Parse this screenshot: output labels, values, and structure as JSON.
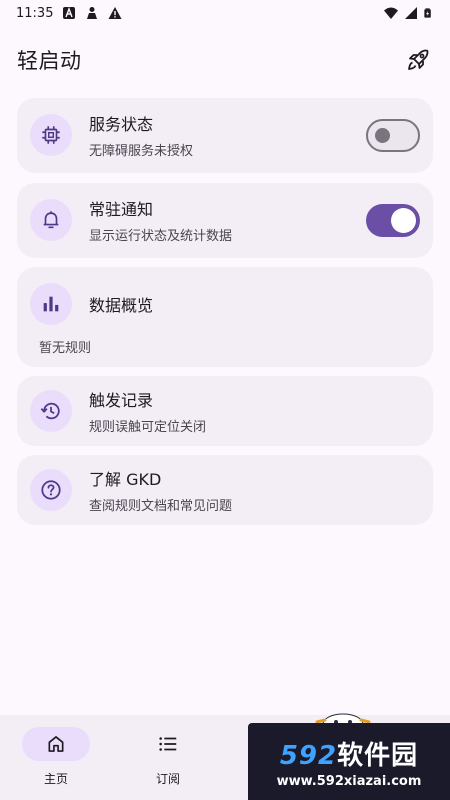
{
  "status_bar": {
    "time": "11:35",
    "icons": [
      "a-badge-icon",
      "person-icon",
      "warning-icon",
      "wifi-icon",
      "signal-icon",
      "battery-icon"
    ]
  },
  "header": {
    "title": "轻启动",
    "action_icon": "rocket-icon"
  },
  "cards": {
    "service": {
      "title": "服务状态",
      "subtitle": "无障碍服务未授权",
      "icon": "chip-icon",
      "switch_on": false
    },
    "notify": {
      "title": "常驻通知",
      "subtitle": "显示运行状态及统计数据",
      "icon": "bell-icon",
      "switch_on": true
    },
    "stats": {
      "title": "数据概览",
      "empty": "暂无规则",
      "icon": "bar-chart-icon"
    },
    "history": {
      "title": "触发记录",
      "subtitle": "规则误触可定位关闭",
      "icon": "history-icon"
    },
    "about": {
      "title": "了解 GKD",
      "subtitle": "查阅规则文档和常见问题",
      "icon": "help-icon"
    }
  },
  "bottom_nav": {
    "items": [
      {
        "label": "主页",
        "icon": "home-icon",
        "active": true
      },
      {
        "label": "订阅",
        "icon": "list-icon",
        "active": false
      }
    ]
  },
  "watermark": {
    "brand_number": "592",
    "brand_text": "软件园",
    "url": "www.592xiazai.com"
  },
  "colors": {
    "background": "#fdf7fe",
    "card": "#f3edf6",
    "icon_bg": "#e9ddfb",
    "accent": "#6b4fa6",
    "icon_fg": "#4f378a"
  }
}
